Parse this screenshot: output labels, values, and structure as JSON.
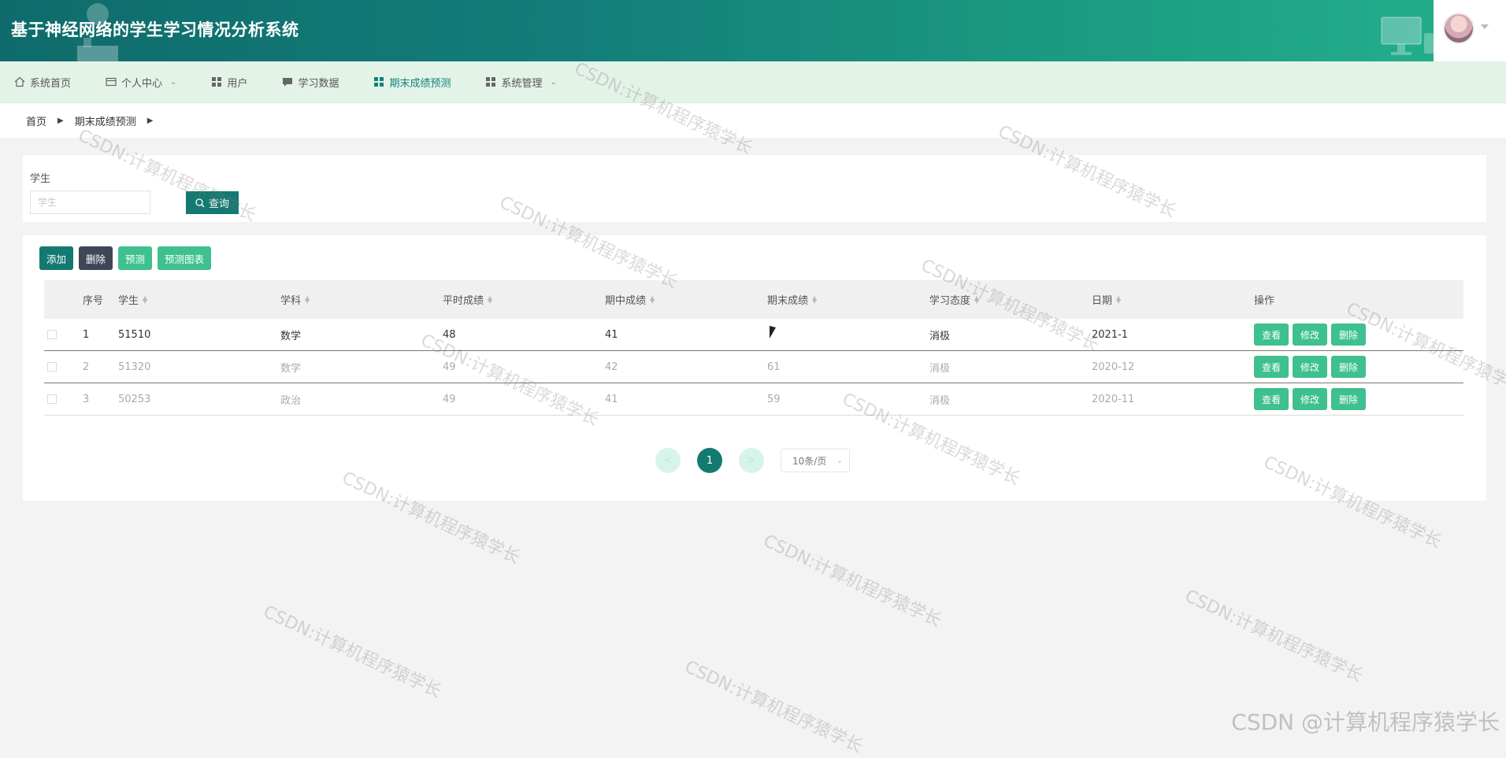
{
  "header": {
    "title": "基于神经网络的学生学习情况分析系统",
    "colors": {
      "primary": "#137a72",
      "accent": "#3ec08f",
      "dark": "#3d4756"
    }
  },
  "nav": {
    "items": [
      {
        "label": "系统首页",
        "icon": "home-icon"
      },
      {
        "label": "个人中心",
        "icon": "id-card-icon",
        "has_dropdown": true
      },
      {
        "label": "用户",
        "icon": "grid-icon"
      },
      {
        "label": "学习数据",
        "icon": "chat-icon"
      },
      {
        "label": "期末成绩预测",
        "icon": "grid-icon",
        "active": true
      },
      {
        "label": "系统管理",
        "icon": "grid-icon",
        "has_dropdown": true
      }
    ]
  },
  "breadcrumb": {
    "home": "首页",
    "current": "期末成绩预测"
  },
  "search": {
    "label": "学生",
    "placeholder": "学生",
    "button": "查询"
  },
  "toolbar": {
    "add": "添加",
    "delete": "删除",
    "predict": "预测",
    "chart": "预测图表"
  },
  "table": {
    "headers": [
      "序号",
      "学生",
      "学科",
      "平时成绩",
      "期中成绩",
      "期末成绩",
      "学习态度",
      "日期",
      "操作"
    ],
    "rows": [
      {
        "idx": "1",
        "student": "51510",
        "subject": "数学",
        "avg": "48",
        "mid": "41",
        "final": "",
        "attitude": "消极",
        "date": "2021-1"
      },
      {
        "idx": "2",
        "student": "51320",
        "subject": "数学",
        "avg": "49",
        "mid": "42",
        "final": "61",
        "attitude": "消极",
        "date": "2020-12"
      },
      {
        "idx": "3",
        "student": "50253",
        "subject": "政治",
        "avg": "49",
        "mid": "41",
        "final": "59",
        "attitude": "消极",
        "date": "2020-11"
      }
    ],
    "row_actions": {
      "view": "查看",
      "edit": "修改",
      "delete": "删除"
    }
  },
  "pager": {
    "prev": "<",
    "current": "1",
    "next": ">",
    "page_size": "10条/页"
  },
  "watermark": {
    "text": "CSDN:计算机程序猿学长",
    "corner": "CSDN @计算机程序猿学长"
  }
}
